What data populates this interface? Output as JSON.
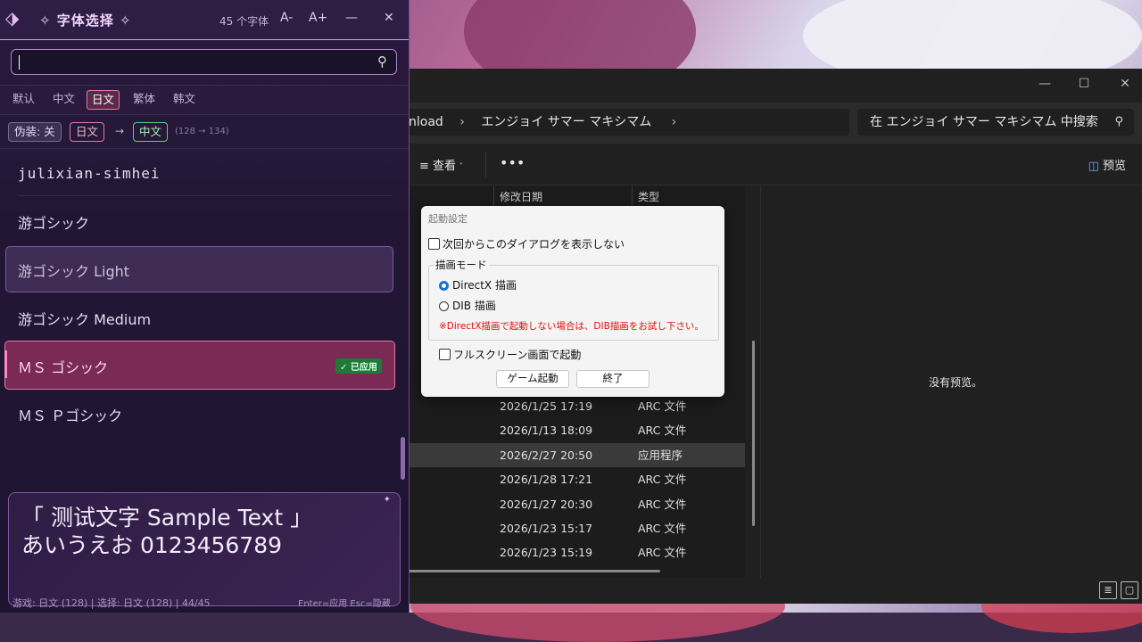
{
  "explorer": {
    "breadcrumb": [
      "nload",
      "エンジョイ サマー マキシマム"
    ],
    "search_placeholder": "在 エンジョイ サマー マキシマム 中搜索",
    "view_label": "查看",
    "preview_label": "预览",
    "columns": {
      "date": "修改日期",
      "type": "类型"
    },
    "rows": [
      {
        "date": "2026/1/25 17:19",
        "type": "ARC 文件",
        "selected": false
      },
      {
        "date": "2026/1/13 18:09",
        "type": "ARC 文件",
        "selected": false
      },
      {
        "date": "2026/2/27 20:50",
        "type": "应用程序",
        "selected": true
      },
      {
        "date": "2026/1/28 17:21",
        "type": "ARC 文件",
        "selected": false
      },
      {
        "date": "2026/1/27 20:30",
        "type": "ARC 文件",
        "selected": false
      },
      {
        "date": "2026/1/23 15:17",
        "type": "ARC 文件",
        "selected": false
      },
      {
        "date": "2026/1/23 15:19",
        "type": "ARC 文件",
        "selected": false
      }
    ],
    "no_preview": "没有预览。"
  },
  "dialog": {
    "title": "起動設定",
    "dont_show": "次回からこのダイアログを表示しない",
    "group_label": "描画モード",
    "radio_directx": "DirectX 描画",
    "radio_dib": "DIB 描画",
    "warning": "※DirectX描画で起動しない場合は、DIB描画をお試し下さい。",
    "fullscreen": "フルスクリーン画面で起動",
    "start_button": "ゲーム起動",
    "exit_button": "終了"
  },
  "picker": {
    "title": "✧ 字体选择 ✧",
    "font_count": "45 个字体",
    "decrease": "A-",
    "increase": "A+",
    "minimize": "—",
    "close": "✕",
    "tabs": [
      "默认",
      "中文",
      "日文",
      "繁体",
      "韩文"
    ],
    "active_tab": "日文",
    "fake_toggle": "伪装: 关",
    "conv_from": "日文",
    "conv_arrow": "→",
    "conv_to": "中文",
    "conv_range": "(128 → 134)",
    "fonts": [
      {
        "name": "julixian-simhei",
        "state": "normal"
      },
      {
        "name": "游ゴシック",
        "state": "normal"
      },
      {
        "name": "游ゴシック Light",
        "state": "hover"
      },
      {
        "name": "游ゴシック Medium",
        "state": "normal"
      },
      {
        "name": "ＭＳ ゴシック",
        "state": "applied"
      },
      {
        "name": "ＭＳ Ｐゴシック",
        "state": "normal"
      }
    ],
    "applied_badge": "✓ 已应用",
    "preview_line1": "「 测试文字 Sample Text 」",
    "preview_line2": "あいうえお 0123456789",
    "status": "游戏: 日文 (128) | 选择: 日文 (128) | 44/45",
    "hint": "Enter=应用  Esc=隐藏"
  },
  "colors": {
    "accent": "#e07aa8",
    "applied_bg": "#7a2a55",
    "badge_green": "#2aa84a"
  }
}
